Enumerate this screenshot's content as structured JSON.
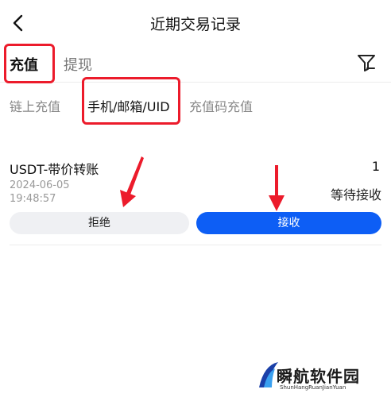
{
  "header": {
    "title": "近期交易记录",
    "back_icon": "chevron-left-icon"
  },
  "tabs": [
    {
      "label": "充值",
      "active": true
    },
    {
      "label": "提现",
      "active": false
    }
  ],
  "filter_icon": "filter-funnel-icon",
  "subtabs": [
    {
      "label": "链上充值",
      "active": false
    },
    {
      "label": "手机/邮箱/UID",
      "active": true
    },
    {
      "label": "充值码充值",
      "active": false
    }
  ],
  "record": {
    "title": "USDT-带价转账",
    "amount": "1",
    "date": "2024-06-05",
    "time": "19:48:57",
    "status": "等待接收",
    "reject_label": "拒绝",
    "accept_label": "接收"
  },
  "colors": {
    "accent": "#0d5ef5",
    "annotation": "#ec1b2b"
  },
  "watermark": {
    "main": "瞬航软件园",
    "sub": "ShunHangRuanJianYuan"
  }
}
